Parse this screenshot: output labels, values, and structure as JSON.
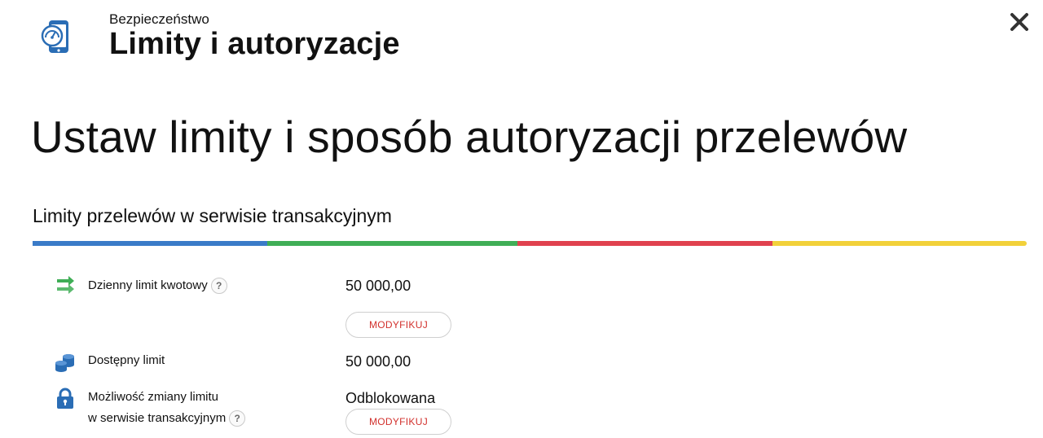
{
  "header": {
    "eyebrow": "Bezpieczeństwo",
    "title": "Limity i autoryzacje",
    "icon": "phone-speedometer-icon",
    "close_icon": "close-icon"
  },
  "headline": "Ustaw limity i sposób autoryzacji przelewów",
  "section": {
    "title": "Limity przelewów w serwisie transakcyjnym",
    "bar_colors": [
      "#3a7bc8",
      "#3fae56",
      "#e0414f",
      "#f2d13a"
    ]
  },
  "rows": {
    "daily": {
      "label": "Dzienny limit kwotowy",
      "value": "50 000,00",
      "button": "MODYFIKUJ",
      "icon": "transfer-arrows-icon",
      "help": "?"
    },
    "available": {
      "label": "Dostępny limit",
      "value": "50 000,00",
      "icon": "coins-icon"
    },
    "change": {
      "label_line1": "Możliwość zmiany limitu",
      "label_line2": "w serwisie transakcyjnym",
      "value": "Odblokowana",
      "button": "MODYFIKUJ",
      "icon": "padlock-icon",
      "help": "?"
    }
  },
  "colors": {
    "accent_red": "#d2302c",
    "icon_blue": "#2a6db5",
    "icon_green": "#3fae56"
  }
}
